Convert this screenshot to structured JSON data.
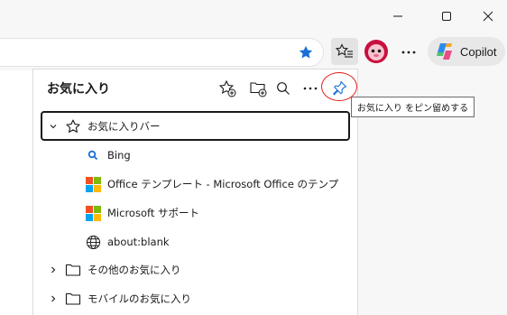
{
  "window": {
    "minimize_icon": "minimize-icon",
    "maximize_icon": "maximize-icon",
    "close_icon": "close-icon"
  },
  "toolbar": {
    "copilot_label": "Copilot"
  },
  "favorites_panel": {
    "title": "お気に入り",
    "pin_tooltip": "お気に入り をピン留めする",
    "items": [
      {
        "label": "お気に入りバー",
        "icon": "star-outline-icon",
        "expanded": true
      },
      {
        "label": "Bing",
        "icon": "bing-search-icon"
      },
      {
        "label": "Office テンプレート - Microsoft Office のテンプ",
        "icon": "microsoft-logo-icon"
      },
      {
        "label": "Microsoft サポート",
        "icon": "microsoft-logo-icon"
      },
      {
        "label": "about:blank",
        "icon": "globe-icon"
      },
      {
        "label": "その他のお気に入り",
        "icon": "folder-icon",
        "expanded": false
      },
      {
        "label": "モバイルのお気に入り",
        "icon": "folder-icon",
        "expanded": false
      }
    ]
  },
  "colors": {
    "accent_blue": "#1a6fd6",
    "highlight_red": "#e0201b",
    "ms_red": "#f25022",
    "ms_green": "#7fba00",
    "ms_blue": "#00a4ef",
    "ms_yellow": "#ffb900"
  }
}
